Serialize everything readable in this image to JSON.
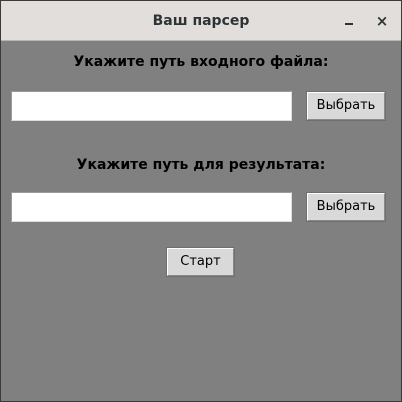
{
  "window": {
    "title": "Ваш парсер",
    "minimize_icon": "minimize-icon",
    "close_icon": "close-icon",
    "close_glyph": "×"
  },
  "input_section": {
    "label": "Укажите путь входного файла:",
    "value": "",
    "browse_label": "Выбрать"
  },
  "output_section": {
    "label": "Укажите путь для результата:",
    "value": "",
    "browse_label": "Выбрать"
  },
  "start_button": {
    "label": "Старт"
  },
  "colors": {
    "window_background": "#808080",
    "titlebar": "#e1dedb",
    "button": "#d9d9d9",
    "input": "#ffffff"
  }
}
